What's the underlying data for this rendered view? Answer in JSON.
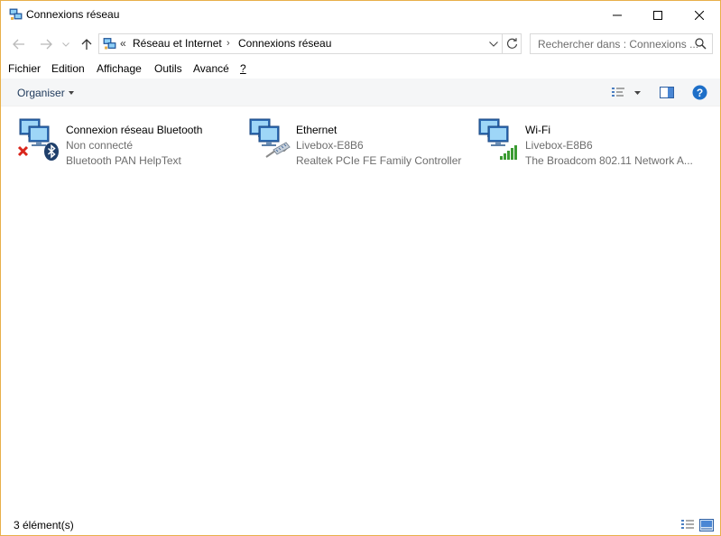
{
  "window": {
    "title": "Connexions réseau"
  },
  "address": {
    "overflow": "«",
    "crumbs": [
      "Réseau et Internet",
      "Connexions réseau"
    ],
    "separator": "›"
  },
  "search": {
    "placeholder": "Rechercher dans : Connexions ..."
  },
  "menu": {
    "items": [
      {
        "label": "Fichier"
      },
      {
        "label": "Edition"
      },
      {
        "label": "Affichage"
      },
      {
        "label": "Outils"
      },
      {
        "label": "Avancé"
      },
      {
        "label": "?"
      }
    ]
  },
  "toolbar": {
    "organize_label": "Organiser"
  },
  "connections": [
    {
      "name": "Connexion réseau Bluetooth",
      "status": "Non connecté",
      "device": "Bluetooth PAN HelpText",
      "icon": "bluetooth-network-icon"
    },
    {
      "name": "Ethernet",
      "status": "Livebox-E8B6",
      "device": "Realtek PCIe FE Family Controller",
      "icon": "ethernet-network-icon"
    },
    {
      "name": "Wi-Fi",
      "status": "Livebox-E8B6",
      "device": "The Broadcom 802.11 Network A...",
      "icon": "wifi-network-icon"
    }
  ],
  "status": {
    "count": "3 élément(s)"
  },
  "colors": {
    "accent": "#1e73be",
    "window_border": "#e8b04a",
    "help": "#1e6fc8",
    "wifi_signal": "#3b9b32",
    "error": "#d9261c"
  }
}
